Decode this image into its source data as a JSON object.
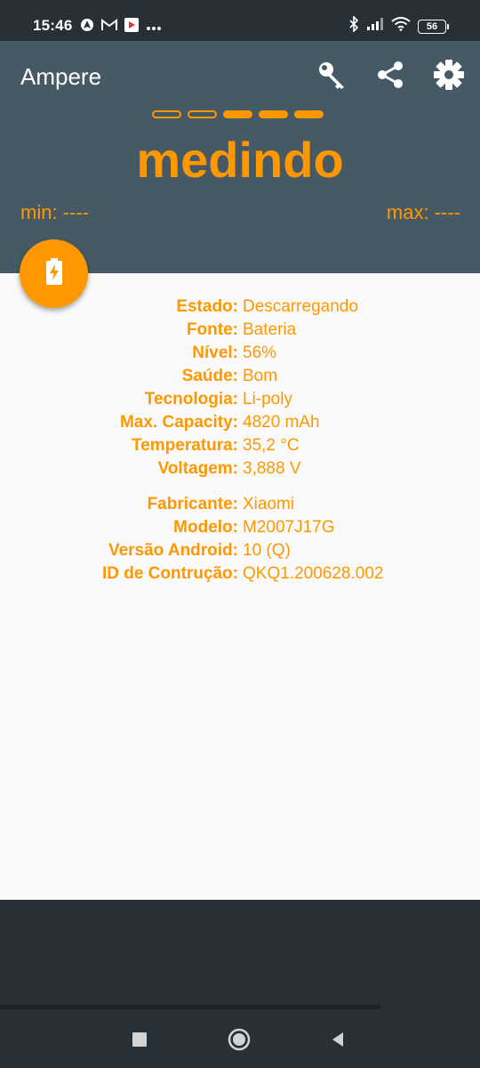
{
  "status_bar": {
    "time": "15:46",
    "left_icons": [
      "android-auto-icon",
      "gmail-icon",
      "youtube-music-icon",
      "more-icon"
    ],
    "right_icons": [
      "bluetooth-icon",
      "signal-icon",
      "wifi-icon",
      "battery-icon"
    ],
    "battery_level": "56"
  },
  "header": {
    "title": "Ampere",
    "actions": [
      "key-icon",
      "share-icon",
      "settings-icon"
    ],
    "progress": {
      "total_segments": 5,
      "filled_segments": 3
    },
    "status_word": "medindo",
    "min_label": "min: ----",
    "max_label": "max: ----"
  },
  "fab": {
    "icon": "battery-charging-icon"
  },
  "battery_info": [
    {
      "label": "Estado:",
      "value": "Descarregando"
    },
    {
      "label": "Fonte:",
      "value": "Bateria"
    },
    {
      "label": "Nível:",
      "value": "56%"
    },
    {
      "label": "Saúde:",
      "value": "Bom"
    },
    {
      "label": "Tecnologia:",
      "value": "Li-poly"
    },
    {
      "label": "Max. Capacity:",
      "value": "4820 mAh"
    },
    {
      "label": "Temperatura:",
      "value": "35,2 °C"
    },
    {
      "label": "Voltagem:",
      "value": "3,888 V"
    }
  ],
  "device_info": [
    {
      "label": "Fabricante:",
      "value": "Xiaomi"
    },
    {
      "label": "Modelo:",
      "value": "M2007J17G"
    },
    {
      "label": "Versão Android:",
      "value": "10 (Q)"
    },
    {
      "label": "ID de Contrução:",
      "value": "QKQ1.200628.002"
    }
  ],
  "nav": [
    "recents-square-icon",
    "home-circle-icon",
    "back-triangle-icon"
  ],
  "colors": {
    "accent": "#ff9800",
    "header_bg": "#455a64",
    "system_bar_bg": "#263036",
    "content_bg": "#fafafa"
  }
}
